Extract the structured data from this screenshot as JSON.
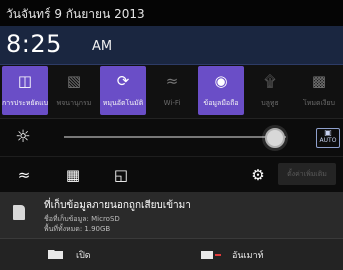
{
  "status_bar": {
    "date": "วันจันทร์ 9 กันยายน 2013"
  },
  "clock": {
    "time": "8:25",
    "ampm": "AM"
  },
  "quick_settings": [
    {
      "label": "การประหยัดแบบสมาร์ต",
      "state": "on"
    },
    {
      "label": "พจนานุกรม",
      "state": "off"
    },
    {
      "label": "หมุนอัตโนมัติ",
      "state": "on"
    },
    {
      "label": "Wi-Fi",
      "state": "off"
    },
    {
      "label": "ข้อมูลมือถือ",
      "state": "on"
    },
    {
      "label": "บลูทูธ",
      "state": "off"
    },
    {
      "label": "โหมดเงียบ",
      "state": "off"
    }
  ],
  "brightness": {
    "level": 0.95,
    "auto_label": "AUTO"
  },
  "toolbar": {
    "more_label": "ตั้งค่าเพิ่มเติม"
  },
  "notification": {
    "title": "ที่เก็บข้อมูลภายนอกถูกเสียบเข้ามา",
    "line1": "ชื่อที่เก็บข้อมูล: MicroSD",
    "line2": "พื้นที่ทั้งหมด: 1.90GB",
    "open_label": "เปิด",
    "unmount_label": "อันเมาท์"
  },
  "colors": {
    "accent": "#6a4ec7",
    "header": "#1a2640"
  }
}
